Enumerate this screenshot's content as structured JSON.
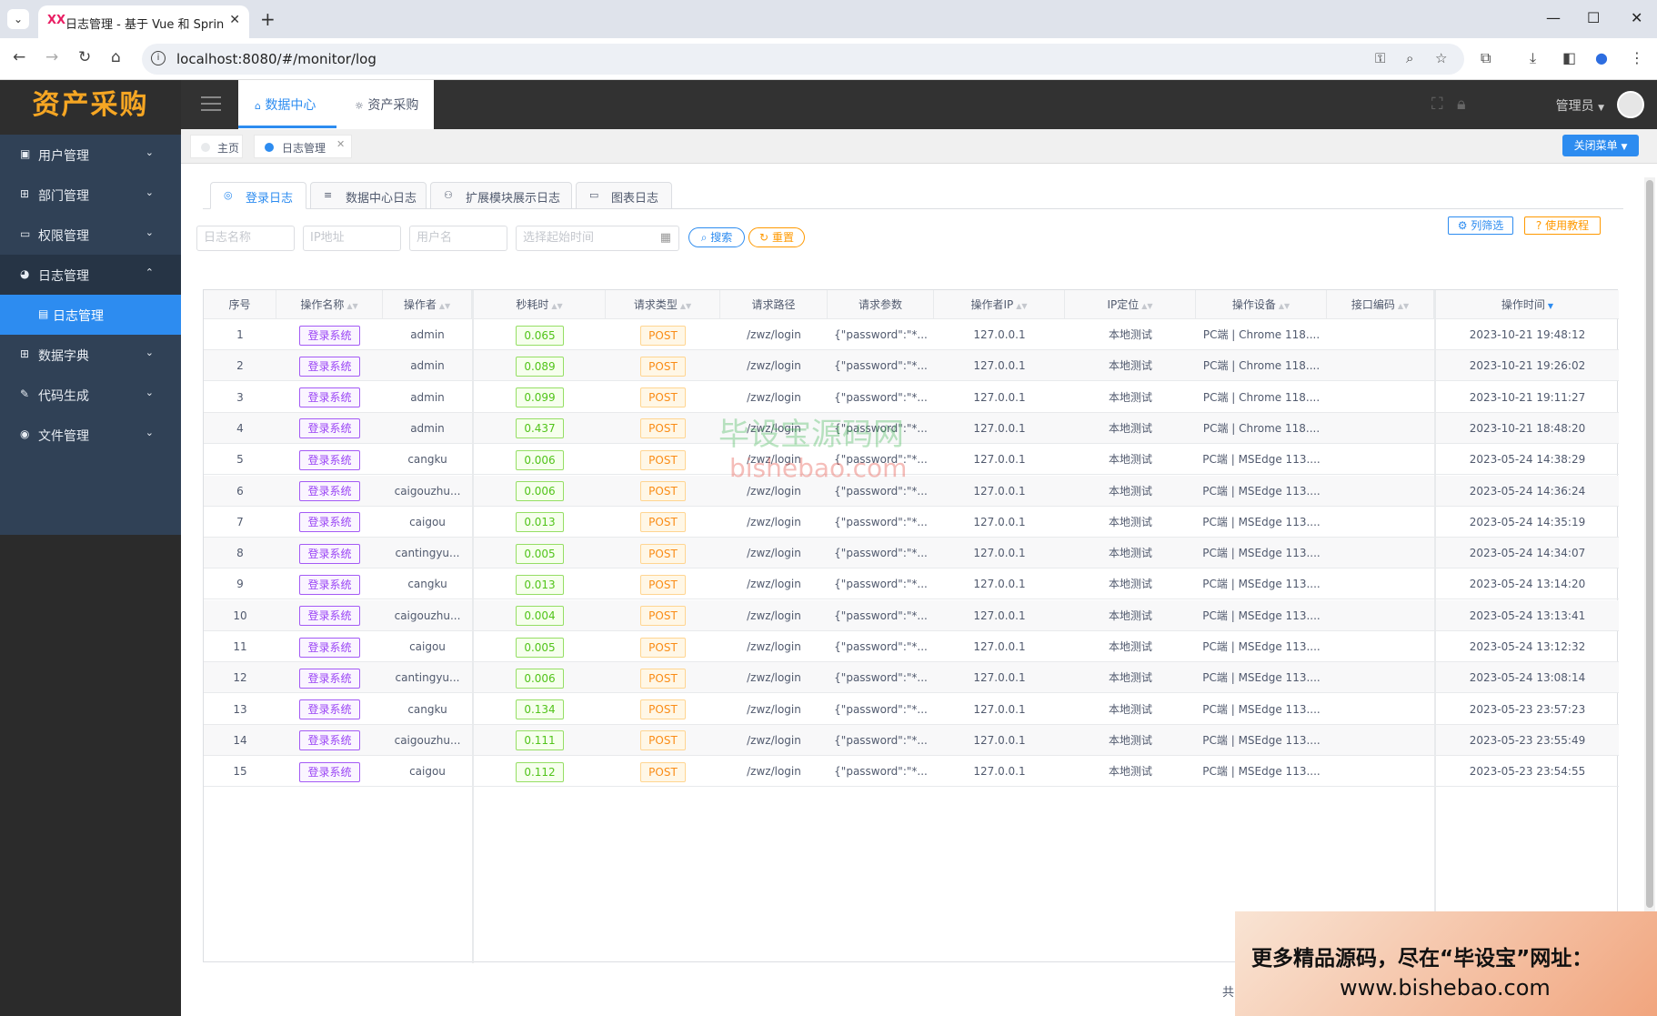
{
  "browser": {
    "tab_title": "日志管理 - 基于 Vue 和 Spring",
    "favicon": "XX",
    "url": "localhost:8080/#/monitor/log"
  },
  "sidebar": {
    "logo": "资产采购",
    "items": [
      {
        "label": "用户管理",
        "icon": "user-icon"
      },
      {
        "label": "部门管理",
        "icon": "grid-icon"
      },
      {
        "label": "权限管理",
        "icon": "monitor-icon"
      },
      {
        "label": "日志管理",
        "icon": "log-icon"
      },
      {
        "label": "日志管理",
        "icon": "doc-icon"
      },
      {
        "label": "数据字典",
        "icon": "grid-icon"
      },
      {
        "label": "代码生成",
        "icon": "pen-icon"
      },
      {
        "label": "文件管理",
        "icon": "file-icon"
      }
    ]
  },
  "topnav": {
    "menu": [
      {
        "label": "数据中心"
      },
      {
        "label": "资产采购"
      }
    ],
    "user": "管理员"
  },
  "tags": {
    "home": "主页",
    "current": "日志管理",
    "close_menu": "关闭菜单"
  },
  "subtabs": [
    {
      "label": "登录日志"
    },
    {
      "label": "数据中心日志"
    },
    {
      "label": "扩展模块展示日志"
    },
    {
      "label": "图表日志"
    }
  ],
  "filters": {
    "name_placeholder": "日志名称",
    "ip_placeholder": "IP地址",
    "user_placeholder": "用户名",
    "time_placeholder": "选择起始时间",
    "search": "搜索",
    "reset": "重置",
    "column_filter": "列筛选",
    "tutorial": "使用教程"
  },
  "table": {
    "headers": [
      "序号",
      "操作名称",
      "操作者",
      "秒耗时",
      "请求类型",
      "请求路径",
      "请求参数",
      "操作者IP",
      "IP定位",
      "操作设备",
      "接口编码",
      "操作时间"
    ],
    "rows": [
      [
        "1",
        "登录系统",
        "admin",
        "0.065",
        "POST",
        "/zwz/login",
        "{\"password\":\"*...",
        "127.0.0.1",
        "本地测试",
        "PC端 | Chrome 118....",
        "",
        "2023-10-21 19:48:12"
      ],
      [
        "2",
        "登录系统",
        "admin",
        "0.089",
        "POST",
        "/zwz/login",
        "{\"password\":\"*...",
        "127.0.0.1",
        "本地测试",
        "PC端 | Chrome 118....",
        "",
        "2023-10-21 19:26:02"
      ],
      [
        "3",
        "登录系统",
        "admin",
        "0.099",
        "POST",
        "/zwz/login",
        "{\"password\":\"*...",
        "127.0.0.1",
        "本地测试",
        "PC端 | Chrome 118....",
        "",
        "2023-10-21 19:11:27"
      ],
      [
        "4",
        "登录系统",
        "admin",
        "0.437",
        "POST",
        "/zwz/login",
        "{\"password\":\"*...",
        "127.0.0.1",
        "本地测试",
        "PC端 | Chrome 118....",
        "",
        "2023-10-21 18:48:20"
      ],
      [
        "5",
        "登录系统",
        "cangku",
        "0.006",
        "POST",
        "/zwz/login",
        "{\"password\":\"*...",
        "127.0.0.1",
        "本地测试",
        "PC端 | MSEdge 113....",
        "",
        "2023-05-24 14:38:29"
      ],
      [
        "6",
        "登录系统",
        "caigouzhu...",
        "0.006",
        "POST",
        "/zwz/login",
        "{\"password\":\"*...",
        "127.0.0.1",
        "本地测试",
        "PC端 | MSEdge 113....",
        "",
        "2023-05-24 14:36:24"
      ],
      [
        "7",
        "登录系统",
        "caigou",
        "0.013",
        "POST",
        "/zwz/login",
        "{\"password\":\"*...",
        "127.0.0.1",
        "本地测试",
        "PC端 | MSEdge 113....",
        "",
        "2023-05-24 14:35:19"
      ],
      [
        "8",
        "登录系统",
        "cantingyu...",
        "0.005",
        "POST",
        "/zwz/login",
        "{\"password\":\"*...",
        "127.0.0.1",
        "本地测试",
        "PC端 | MSEdge 113....",
        "",
        "2023-05-24 14:34:07"
      ],
      [
        "9",
        "登录系统",
        "cangku",
        "0.013",
        "POST",
        "/zwz/login",
        "{\"password\":\"*...",
        "127.0.0.1",
        "本地测试",
        "PC端 | MSEdge 113....",
        "",
        "2023-05-24 13:14:20"
      ],
      [
        "10",
        "登录系统",
        "caigouzhu...",
        "0.004",
        "POST",
        "/zwz/login",
        "{\"password\":\"*...",
        "127.0.0.1",
        "本地测试",
        "PC端 | MSEdge 113....",
        "",
        "2023-05-24 13:13:41"
      ],
      [
        "11",
        "登录系统",
        "caigou",
        "0.005",
        "POST",
        "/zwz/login",
        "{\"password\":\"*...",
        "127.0.0.1",
        "本地测试",
        "PC端 | MSEdge 113....",
        "",
        "2023-05-24 13:12:32"
      ],
      [
        "12",
        "登录系统",
        "cantingyu...",
        "0.006",
        "POST",
        "/zwz/login",
        "{\"password\":\"*...",
        "127.0.0.1",
        "本地测试",
        "PC端 | MSEdge 113....",
        "",
        "2023-05-24 13:08:14"
      ],
      [
        "13",
        "登录系统",
        "cangku",
        "0.134",
        "POST",
        "/zwz/login",
        "{\"password\":\"*...",
        "127.0.0.1",
        "本地测试",
        "PC端 | MSEdge 113....",
        "",
        "2023-05-23 23:57:23"
      ],
      [
        "14",
        "登录系统",
        "caigouzhu...",
        "0.111",
        "POST",
        "/zwz/login",
        "{\"password\":\"*...",
        "127.0.0.1",
        "本地测试",
        "PC端 | MSEdge 113....",
        "",
        "2023-05-23 23:55:49"
      ],
      [
        "15",
        "登录系统",
        "caigou",
        "0.112",
        "POST",
        "/zwz/login",
        "{\"password\":\"*...",
        "127.0.0.1",
        "本地测试",
        "PC端 | MSEdge 113....",
        "",
        "2023-05-23 23:54:55"
      ]
    ]
  },
  "watermark": {
    "cn": "毕设宝源码网",
    "en": "bishebao.com"
  },
  "ad": {
    "line1": "更多精品源码，尽在“毕设宝”网址：",
    "line2": "www.bishebao.com"
  },
  "footer_total": "共",
  "colors": {
    "accent": "#2d8cf0",
    "sidebar": "#304156",
    "topbar": "#323232",
    "warning": "#ff9900"
  }
}
